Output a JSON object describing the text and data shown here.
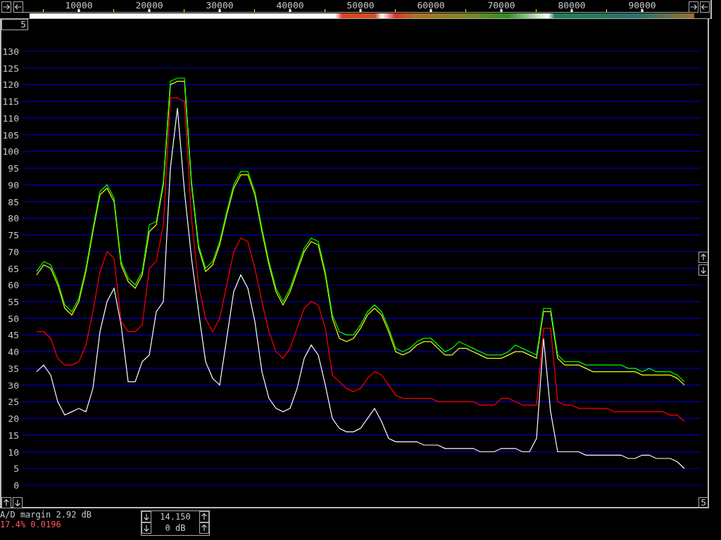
{
  "spectrum": {
    "chart_data": {
      "type": "line",
      "x": [
        4000,
        5000,
        6000,
        7000,
        8000,
        9000,
        10000,
        11000,
        12000,
        13000,
        14000,
        15000,
        16000,
        17000,
        18000,
        19000,
        20000,
        21000,
        22000,
        23000,
        24000,
        25000,
        26000,
        27000,
        28000,
        29000,
        30000,
        31000,
        32000,
        33000,
        34000,
        35000,
        36000,
        37000,
        38000,
        39000,
        40000,
        41000,
        42000,
        43000,
        44000,
        45000,
        46000,
        47000,
        48000,
        49000,
        50000,
        51000,
        52000,
        53000,
        54000,
        55000,
        56000,
        57000,
        58000,
        59000,
        60000,
        61000,
        62000,
        63000,
        64000,
        65000,
        66000,
        67000,
        68000,
        69000,
        70000,
        71000,
        72000,
        73000,
        74000,
        75000,
        76000,
        77000,
        78000,
        79000,
        80000,
        81000,
        82000,
        83000,
        84000,
        85000,
        86000,
        87000,
        88000,
        89000,
        90000,
        91000,
        92000,
        93000,
        94000,
        95000,
        96000
      ],
      "series": [
        {
          "color": "#ffffff",
          "values": [
            34,
            36,
            33,
            25,
            21,
            22,
            23,
            22,
            29,
            46,
            55,
            59,
            48,
            31,
            31,
            37,
            39,
            52,
            55,
            95,
            113,
            88,
            68,
            52,
            37,
            32,
            30,
            44,
            58,
            63,
            59,
            49,
            34,
            26,
            23,
            22,
            23,
            29,
            38,
            42,
            39,
            30,
            20,
            17,
            16,
            16,
            17,
            20,
            23,
            19,
            14,
            13,
            13,
            13,
            13,
            12,
            12,
            12,
            11,
            11,
            11,
            11,
            11,
            10,
            10,
            10,
            11,
            11,
            11,
            10,
            10,
            14,
            44,
            22,
            10,
            10,
            10,
            10,
            9,
            9,
            9,
            9,
            9,
            9,
            8,
            8,
            9,
            9,
            8,
            8,
            8,
            7,
            5
          ]
        },
        {
          "color": "#ff0000",
          "values": [
            46,
            46,
            44,
            38,
            36,
            36,
            37,
            42,
            52,
            64,
            70,
            68,
            49,
            46,
            46,
            48,
            65,
            67,
            78,
            116,
            116,
            115,
            80,
            60,
            50,
            46,
            50,
            60,
            70,
            74,
            73,
            65,
            55,
            46,
            40,
            38,
            41,
            47,
            53,
            55,
            54,
            47,
            33,
            31,
            29,
            28,
            29,
            32,
            34,
            33,
            30,
            27,
            26,
            26,
            26,
            26,
            26,
            25,
            25,
            25,
            25,
            25,
            25,
            24,
            24,
            24,
            26,
            26,
            25,
            24,
            24,
            24,
            47,
            47,
            25,
            24,
            24,
            23,
            23,
            23,
            23,
            23,
            22,
            22,
            22,
            22,
            22,
            22,
            22,
            22,
            21,
            21,
            19
          ]
        },
        {
          "color": "#ffff00",
          "values": [
            63,
            66,
            65,
            60,
            53,
            51,
            55,
            64,
            76,
            87,
            89,
            85,
            66,
            61,
            59,
            63,
            76,
            78,
            90,
            120,
            121,
            121,
            90,
            71,
            64,
            66,
            72,
            81,
            89,
            93,
            93,
            87,
            76,
            66,
            58,
            54,
            58,
            64,
            70,
            73,
            72,
            63,
            50,
            44,
            43,
            44,
            47,
            51,
            53,
            51,
            46,
            40,
            39,
            40,
            42,
            43,
            43,
            41,
            39,
            39,
            41,
            41,
            40,
            39,
            38,
            38,
            38,
            39,
            40,
            40,
            39,
            38,
            52,
            52,
            38,
            36,
            36,
            36,
            35,
            34,
            34,
            34,
            34,
            34,
            34,
            34,
            33,
            33,
            33,
            33,
            33,
            32,
            30
          ]
        },
        {
          "color": "#00ff00",
          "values": [
            64,
            67,
            66,
            61,
            54,
            52,
            56,
            65,
            77,
            88,
            90,
            86,
            67,
            62,
            60,
            64,
            78,
            79,
            91,
            121,
            122,
            122,
            91,
            72,
            65,
            67,
            73,
            82,
            90,
            94,
            94,
            88,
            77,
            67,
            59,
            55,
            59,
            65,
            71,
            74,
            73,
            64,
            51,
            46,
            45,
            45,
            48,
            52,
            54,
            52,
            47,
            41,
            40,
            41,
            43,
            44,
            44,
            42,
            40,
            41,
            43,
            42,
            41,
            40,
            39,
            39,
            39,
            40,
            42,
            41,
            40,
            39,
            53,
            53,
            39,
            37,
            37,
            37,
            36,
            36,
            36,
            36,
            36,
            36,
            35,
            35,
            34,
            35,
            34,
            34,
            34,
            33,
            31
          ]
        }
      ],
      "xlim": [
        2000,
        98400
      ],
      "ylim": [
        0,
        130
      ],
      "grid": true,
      "xticks": [
        10000,
        20000,
        30000,
        40000,
        50000,
        60000,
        70000,
        80000,
        90000
      ],
      "yticks": [
        0,
        5,
        10,
        15,
        20,
        25,
        30,
        35,
        40,
        45,
        50,
        55,
        60,
        65,
        70,
        75,
        80,
        85,
        90,
        95,
        100,
        105,
        110,
        115,
        120,
        125,
        130
      ]
    }
  },
  "corner_boxes": [
    {
      "label": "5"
    },
    {
      "label": "5"
    }
  ],
  "status": {
    "ad_margin": "A/D margin 2.92 dB",
    "ratio": "17.4% 0.0196"
  },
  "controls": [
    {
      "value": "14.150"
    },
    {
      "value": "0 dB"
    }
  ]
}
